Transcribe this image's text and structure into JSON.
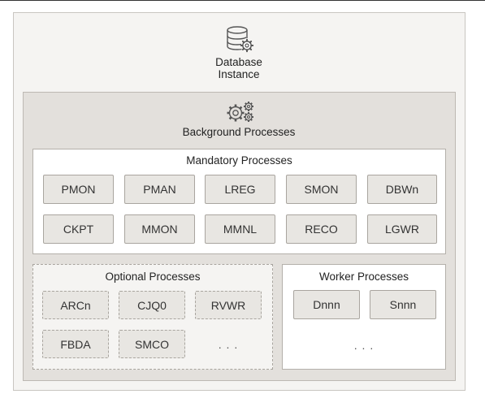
{
  "instance": {
    "title_line1": "Database",
    "title_line2": "Instance",
    "icon": "database-gear-icon"
  },
  "background": {
    "title": "Background Processes",
    "icon": "gears-icon"
  },
  "mandatory": {
    "title": "Mandatory Processes",
    "processes": [
      "PMON",
      "PMAN",
      "LREG",
      "SMON",
      "DBWn",
      "CKPT",
      "MMON",
      "MMNL",
      "RECO",
      "LGWR"
    ]
  },
  "optional": {
    "title": "Optional Processes",
    "processes": [
      "ARCn",
      "CJQ0",
      "RVWR",
      "FBDA",
      "SMCO"
    ],
    "more": ". . ."
  },
  "worker": {
    "title": "Worker Processes",
    "processes": [
      "Dnnn",
      "Snnn"
    ],
    "more": ". . ."
  },
  "colors": {
    "outer_background": "#f5f4f2",
    "panel_background": "#e3e0dc",
    "process_fill": "#e8e6e2",
    "border": "#a9a59f"
  }
}
